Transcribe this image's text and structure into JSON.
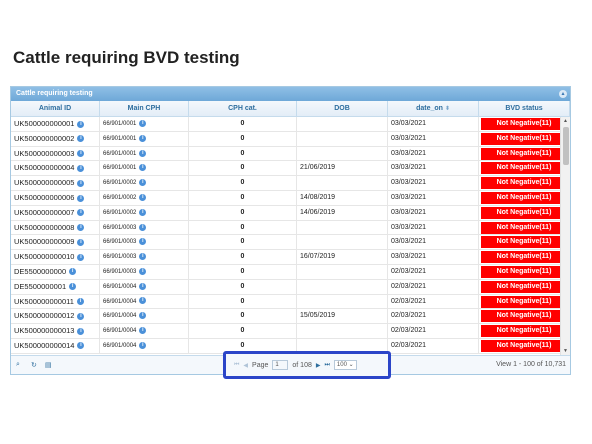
{
  "page": {
    "title": "Cattle requiring BVD testing"
  },
  "grid": {
    "caption": "Cattle requiring testing",
    "columns": {
      "animal_id": "Animal ID",
      "main_cph": "Main CPH",
      "cph_cat": "CPH cat.",
      "dob": "DOB",
      "date_on": "date_on",
      "bvd_status": "BVD status"
    },
    "rows": [
      {
        "id": "UK500000000001",
        "cph": "66/901/0001",
        "cat": "0",
        "dob": "",
        "date_on": "03/03/2021",
        "bvd": "Not Negative(11)"
      },
      {
        "id": "UK500000000002",
        "cph": "66/901/0001",
        "cat": "0",
        "dob": "",
        "date_on": "03/03/2021",
        "bvd": "Not Negative(11)"
      },
      {
        "id": "UK500000000003",
        "cph": "66/901/0001",
        "cat": "0",
        "dob": "",
        "date_on": "03/03/2021",
        "bvd": "Not Negative(11)"
      },
      {
        "id": "UK500000000004",
        "cph": "66/901/0001",
        "cat": "0",
        "dob": "21/06/2019",
        "date_on": "03/03/2021",
        "bvd": "Not Negative(11)"
      },
      {
        "id": "UK500000000005",
        "cph": "66/901/0002",
        "cat": "0",
        "dob": "",
        "date_on": "03/03/2021",
        "bvd": "Not Negative(11)"
      },
      {
        "id": "UK500000000006",
        "cph": "66/901/0002",
        "cat": "0",
        "dob": "14/08/2019",
        "date_on": "03/03/2021",
        "bvd": "Not Negative(11)"
      },
      {
        "id": "UK500000000007",
        "cph": "66/901/0002",
        "cat": "0",
        "dob": "14/06/2019",
        "date_on": "03/03/2021",
        "bvd": "Not Negative(11)"
      },
      {
        "id": "UK500000000008",
        "cph": "66/901/0003",
        "cat": "0",
        "dob": "",
        "date_on": "03/03/2021",
        "bvd": "Not Negative(11)"
      },
      {
        "id": "UK500000000009",
        "cph": "66/901/0003",
        "cat": "0",
        "dob": "",
        "date_on": "03/03/2021",
        "bvd": "Not Negative(11)"
      },
      {
        "id": "UK500000000010",
        "cph": "66/901/0003",
        "cat": "0",
        "dob": "16/07/2019",
        "date_on": "03/03/2021",
        "bvd": "Not Negative(11)"
      },
      {
        "id": "DE5500000000",
        "cph": "66/901/0003",
        "cat": "0",
        "dob": "",
        "date_on": "02/03/2021",
        "bvd": "Not Negative(11)"
      },
      {
        "id": "DE5500000001",
        "cph": "66/901/0004",
        "cat": "0",
        "dob": "",
        "date_on": "02/03/2021",
        "bvd": "Not Negative(11)"
      },
      {
        "id": "UK500000000011",
        "cph": "66/901/0004",
        "cat": "0",
        "dob": "",
        "date_on": "02/03/2021",
        "bvd": "Not Negative(11)"
      },
      {
        "id": "UK500000000012",
        "cph": "66/901/0004",
        "cat": "0",
        "dob": "15/05/2019",
        "date_on": "02/03/2021",
        "bvd": "Not Negative(11)"
      },
      {
        "id": "UK500000000013",
        "cph": "66/901/0004",
        "cat": "0",
        "dob": "",
        "date_on": "02/03/2021",
        "bvd": "Not Negative(11)"
      },
      {
        "id": "UK500000000014",
        "cph": "66/901/0004",
        "cat": "0",
        "dob": "",
        "date_on": "02/03/2021",
        "bvd": "Not Negative(11)"
      }
    ]
  },
  "pager": {
    "page_label": "Page",
    "page_value": "1",
    "of_label": "of 108",
    "page_size": "100",
    "view_info": "View 1 - 100 of 10,731"
  },
  "colors": {
    "status_red": "#ff0000",
    "highlight_border": "#2b45c8",
    "header_blue": "#6ea8d8"
  }
}
